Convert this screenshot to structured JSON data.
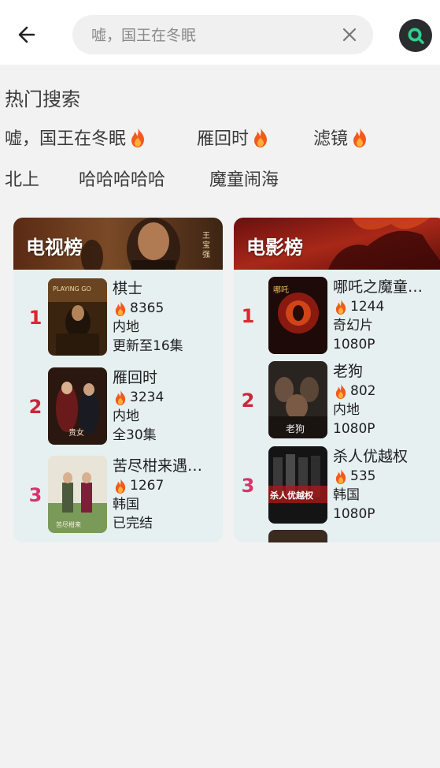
{
  "search": {
    "placeholder": "嘘，国王在冬眠",
    "icons": {
      "back": "back-arrow-icon",
      "clear": "close-icon",
      "search": "search-icon"
    }
  },
  "hot": {
    "title": "热门搜索",
    "terms": [
      {
        "label": "嘘，国王在冬眠",
        "hot": true
      },
      {
        "label": "雁回时",
        "hot": true
      },
      {
        "label": "滤镜",
        "hot": true
      },
      {
        "label": "北上",
        "hot": false
      },
      {
        "label": "哈哈哈哈哈",
        "hot": false
      },
      {
        "label": "魔童闹海",
        "hot": false
      }
    ]
  },
  "tv": {
    "title": "电视榜",
    "items": [
      {
        "rank": "1",
        "name": "棋士",
        "heat": "8365",
        "region": "地",
        "region_full": "内地",
        "status": "更新至16集"
      },
      {
        "rank": "2",
        "name": "雁回时",
        "heat": "3234",
        "region_full": "内地",
        "status": "全30集"
      },
      {
        "rank": "3",
        "name": "苦尽柑来遇…",
        "heat": "1267",
        "region_full": "韩国",
        "status": "已完结"
      }
    ]
  },
  "movie": {
    "title": "电影榜",
    "items": [
      {
        "rank": "1",
        "name": "哪吒之魔童…",
        "heat": "1244",
        "genre": "奇幻片",
        "quality": "1080P"
      },
      {
        "rank": "2",
        "name": "老狗",
        "heat": "802",
        "genre": "内地",
        "quality": "1080P"
      },
      {
        "rank": "3",
        "name": "杀人优越权",
        "heat": "535",
        "genre": "韩国",
        "quality": "1080P"
      }
    ]
  },
  "colors": {
    "rank1": "#e0242e",
    "rank2": "#c8283a",
    "rank3": "#d8336b",
    "fire": "#f25a1c",
    "panel_bg": "#e6f0f0"
  }
}
